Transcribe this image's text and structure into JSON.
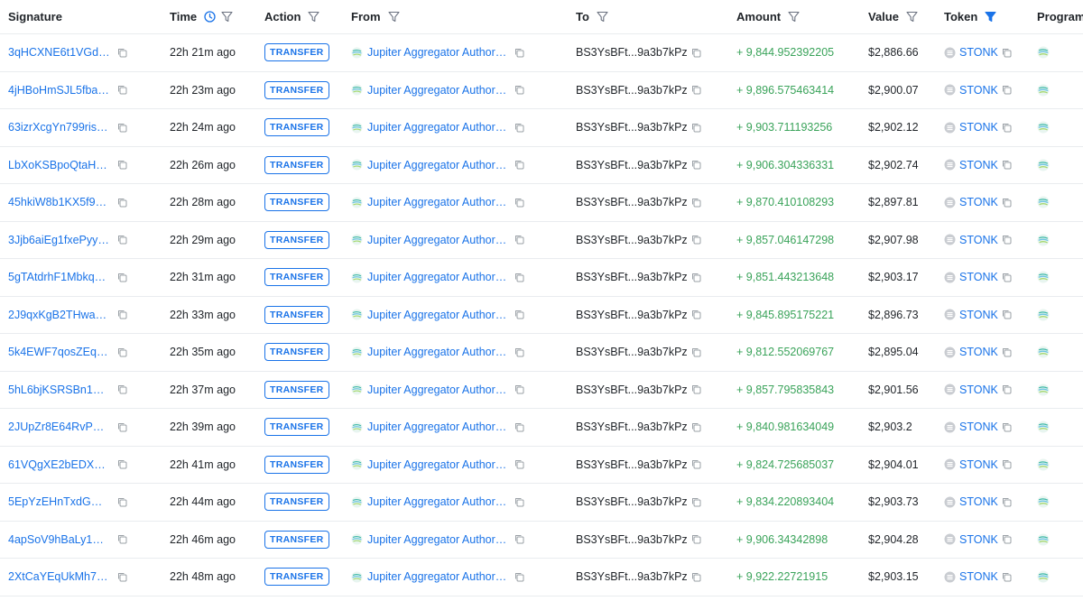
{
  "headers": {
    "signature": "Signature",
    "time": "Time",
    "action": "Action",
    "from": "From",
    "to": "To",
    "amount": "Amount",
    "value": "Value",
    "token": "Token",
    "program": "Program"
  },
  "colors": {
    "link": "#1a73e8",
    "positive_amount": "#3aa35a",
    "active_filter": "#1a73e8"
  },
  "rows": [
    {
      "signature": "3qHCXNE6t1VGdt4...",
      "time": "22h 21m ago",
      "action": "TRANSFER",
      "from": "Jupiter Aggregator Authorit...",
      "to": "BS3YsBFt...9a3b7kPz",
      "amount": "+ 9,844.952392205",
      "value": "$2,886.66",
      "token": "STONK"
    },
    {
      "signature": "4jHBoHmSJL5fban...",
      "time": "22h 23m ago",
      "action": "TRANSFER",
      "from": "Jupiter Aggregator Authorit...",
      "to": "BS3YsBFt...9a3b7kPz",
      "amount": "+ 9,896.575463414",
      "value": "$2,900.07",
      "token": "STONK"
    },
    {
      "signature": "63izrXcgYn799risJ...",
      "time": "22h 24m ago",
      "action": "TRANSFER",
      "from": "Jupiter Aggregator Authorit...",
      "to": "BS3YsBFt...9a3b7kPz",
      "amount": "+ 9,903.711193256",
      "value": "$2,902.12",
      "token": "STONK"
    },
    {
      "signature": "LbXoKSBpoQtaHvi...",
      "time": "22h 26m ago",
      "action": "TRANSFER",
      "from": "Jupiter Aggregator Authorit...",
      "to": "BS3YsBFt...9a3b7kPz",
      "amount": "+ 9,906.304336331",
      "value": "$2,902.74",
      "token": "STONK"
    },
    {
      "signature": "45hkiW8b1KX5f9z...",
      "time": "22h 28m ago",
      "action": "TRANSFER",
      "from": "Jupiter Aggregator Authorit...",
      "to": "BS3YsBFt...9a3b7kPz",
      "amount": "+ 9,870.410108293",
      "value": "$2,897.81",
      "token": "STONK"
    },
    {
      "signature": "3Jjb6aiEg1fxePyyjP...",
      "time": "22h 29m ago",
      "action": "TRANSFER",
      "from": "Jupiter Aggregator Authorit...",
      "to": "BS3YsBFt...9a3b7kPz",
      "amount": "+ 9,857.046147298",
      "value": "$2,907.98",
      "token": "STONK"
    },
    {
      "signature": "5gTAtdrhF1Mbkqz5...",
      "time": "22h 31m ago",
      "action": "TRANSFER",
      "from": "Jupiter Aggregator Authorit...",
      "to": "BS3YsBFt...9a3b7kPz",
      "amount": "+ 9,851.443213648",
      "value": "$2,903.17",
      "token": "STONK"
    },
    {
      "signature": "2J9qxKgB2THwau...",
      "time": "22h 33m ago",
      "action": "TRANSFER",
      "from": "Jupiter Aggregator Authorit...",
      "to": "BS3YsBFt...9a3b7kPz",
      "amount": "+ 9,845.895175221",
      "value": "$2,896.73",
      "token": "STONK"
    },
    {
      "signature": "5k4EWF7qosZEq3F...",
      "time": "22h 35m ago",
      "action": "TRANSFER",
      "from": "Jupiter Aggregator Authorit...",
      "to": "BS3YsBFt...9a3b7kPz",
      "amount": "+ 9,812.552069767",
      "value": "$2,895.04",
      "token": "STONK"
    },
    {
      "signature": "5hL6bjKSRSBn1Wa...",
      "time": "22h 37m ago",
      "action": "TRANSFER",
      "from": "Jupiter Aggregator Authorit...",
      "to": "BS3YsBFt...9a3b7kPz",
      "amount": "+ 9,857.795835843",
      "value": "$2,901.56",
      "token": "STONK"
    },
    {
      "signature": "2JUpZr8E64RvPZHf...",
      "time": "22h 39m ago",
      "action": "TRANSFER",
      "from": "Jupiter Aggregator Authorit...",
      "to": "BS3YsBFt...9a3b7kPz",
      "amount": "+ 9,840.981634049",
      "value": "$2,903.2",
      "token": "STONK"
    },
    {
      "signature": "61VQgXE2bEDXd7Y...",
      "time": "22h 41m ago",
      "action": "TRANSFER",
      "from": "Jupiter Aggregator Authorit...",
      "to": "BS3YsBFt...9a3b7kPz",
      "amount": "+ 9,824.725685037",
      "value": "$2,904.01",
      "token": "STONK"
    },
    {
      "signature": "5EpYzEHnTxdGUKZ...",
      "time": "22h 44m ago",
      "action": "TRANSFER",
      "from": "Jupiter Aggregator Authorit...",
      "to": "BS3YsBFt...9a3b7kPz",
      "amount": "+ 9,834.220893404",
      "value": "$2,903.73",
      "token": "STONK"
    },
    {
      "signature": "4apSoV9hBaLy1Pu...",
      "time": "22h 46m ago",
      "action": "TRANSFER",
      "from": "Jupiter Aggregator Authorit...",
      "to": "BS3YsBFt...9a3b7kPz",
      "amount": "+ 9,906.34342898",
      "value": "$2,904.28",
      "token": "STONK"
    },
    {
      "signature": "2XtCaYEqUkMh7jZ...",
      "time": "22h 48m ago",
      "action": "TRANSFER",
      "from": "Jupiter Aggregator Authorit...",
      "to": "BS3YsBFt...9a3b7kPz",
      "amount": "+ 9,922.22721915",
      "value": "$2,903.15",
      "token": "STONK"
    }
  ]
}
